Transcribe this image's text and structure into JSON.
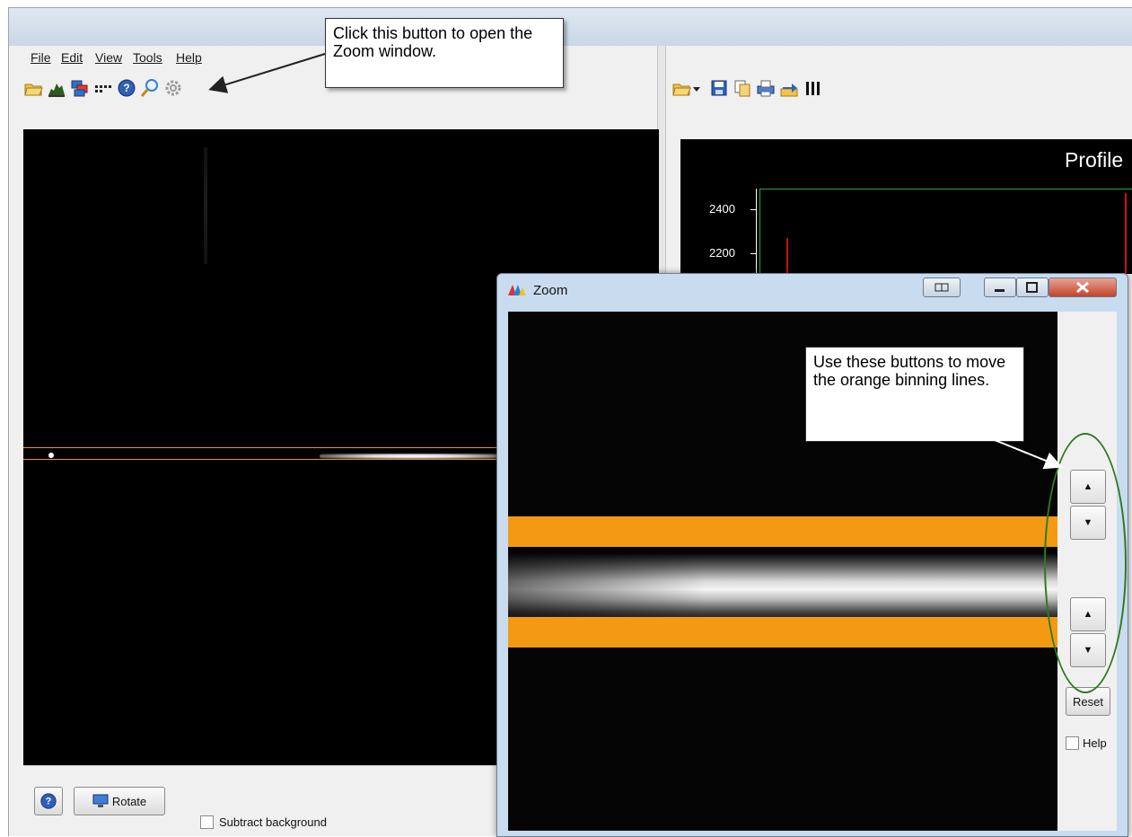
{
  "menubar": {
    "file": "File",
    "edit": "Edit",
    "view": "View",
    "tools": "Tools",
    "help": "Help"
  },
  "left_panel": {
    "rotate_label": "Rotate",
    "subtract_background_label": "Subtract background"
  },
  "plot": {
    "title": "Profile",
    "yticks": [
      "2400",
      "2200"
    ]
  },
  "zoom_window": {
    "title": "Zoom",
    "reset_label": "Reset",
    "help_label": "Help",
    "up_glyph": "▲",
    "down_glyph": "▼"
  },
  "callouts": {
    "zoom_callout": "Click this button to open the Zoom window.",
    "buttons_callout": "Use these buttons to move the orange binning lines."
  },
  "colors": {
    "binning_line": "#f39a12",
    "annotation_ellipse": "#2e7a1e",
    "plot_line": "#d01010"
  }
}
